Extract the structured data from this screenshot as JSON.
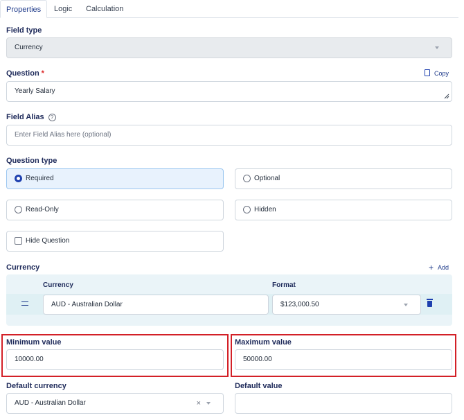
{
  "tabs": [
    "Properties",
    "Logic",
    "Calculation"
  ],
  "field_type": {
    "label": "Field type",
    "value": "Currency"
  },
  "question": {
    "label": "Question",
    "required_mark": "*",
    "value": "Yearly Salary",
    "copy_label": "Copy"
  },
  "field_alias": {
    "label": "Field Alias",
    "help": "?",
    "placeholder": "Enter Field Alias here (optional)"
  },
  "question_type": {
    "label": "Question type",
    "options": [
      "Required",
      "Optional",
      "Read-Only",
      "Hidden"
    ],
    "selected": "Required",
    "hide_question_label": "Hide Question"
  },
  "currency": {
    "label": "Currency",
    "add_label": "Add",
    "col_currency": "Currency",
    "col_format": "Format",
    "row": {
      "currency": "AUD - Australian Dollar",
      "format": "$123,000.50"
    }
  },
  "minimum": {
    "label": "Minimum value",
    "value": "10000.00"
  },
  "maximum": {
    "label": "Maximum value",
    "value": "50000.00"
  },
  "default_currency": {
    "label": "Default currency",
    "value": "AUD - Australian Dollar",
    "clear": "×"
  },
  "default_value": {
    "label": "Default value",
    "value": ""
  },
  "colors": {
    "accent": "#1e40af",
    "highlight": "#d32027",
    "selected_bg": "#e8f2fd"
  }
}
